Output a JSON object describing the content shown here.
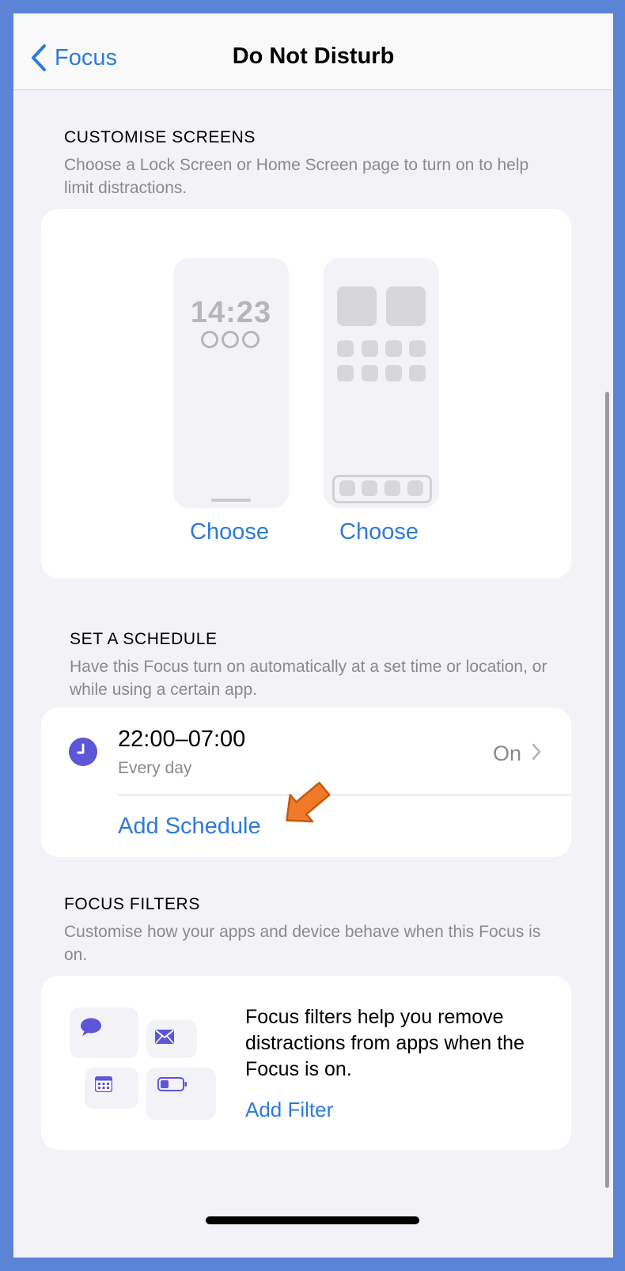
{
  "nav": {
    "back_label": "Focus",
    "title": "Do Not Disturb"
  },
  "customise": {
    "heading": "CUSTOMISE SCREENS",
    "description": "Choose a Lock Screen or Home Screen page to turn on to help limit distractions.",
    "lock_time": "14:23",
    "choose_lock": "Choose",
    "choose_home": "Choose"
  },
  "schedule": {
    "heading": "SET A SCHEDULE",
    "description": "Have this Focus turn on automatically at a set time or location, or while using a certain app.",
    "time_range": "22:00–07:00",
    "repeat": "Every day",
    "state": "On",
    "add_label": "Add Schedule"
  },
  "filters": {
    "heading": "FOCUS FILTERS",
    "description": "Customise how your apps and device behave when this Focus is on.",
    "info": "Focus filters help you remove distractions from apps when the Focus is on.",
    "add_label": "Add Filter"
  },
  "colors": {
    "accent": "#2d7bdc",
    "focus_purple": "#5d56d6",
    "annotation_arrow": "#f07a28"
  },
  "icons": [
    "chevron-left-icon",
    "clock-icon",
    "chevron-right-icon",
    "message-bubble-icon",
    "mail-icon",
    "calendar-icon",
    "battery-icon"
  ]
}
